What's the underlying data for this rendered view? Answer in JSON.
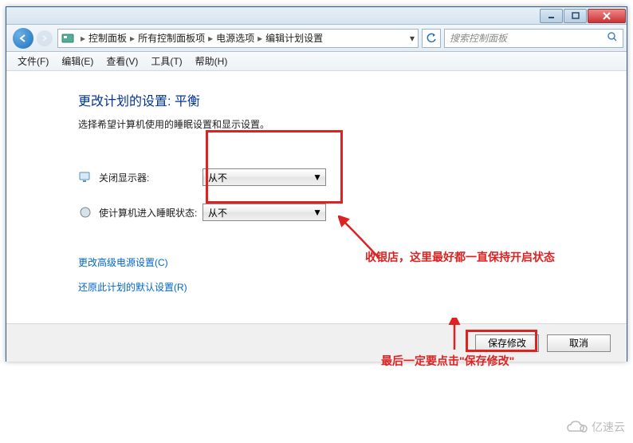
{
  "titlebar": {},
  "breadcrumbs": {
    "item1": "控制面板",
    "item2": "所有控制面板项",
    "item3": "电源选项",
    "item4": "编辑计划设置"
  },
  "search": {
    "placeholder": "搜索控制面板"
  },
  "menu": {
    "file": "文件(F)",
    "edit": "编辑(E)",
    "view": "查看(V)",
    "tools": "工具(T)",
    "help": "帮助(H)"
  },
  "main": {
    "heading": "更改计划的设置: 平衡",
    "subtext": "选择希望计算机使用的睡眠设置和显示设置。",
    "setting1_label": "关闭显示器:",
    "setting1_value": "从不",
    "setting2_label": "使计算机进入睡眠状态:",
    "setting2_value": "从不",
    "link1": "更改高级电源设置(C)",
    "link2": "还原此计划的默认设置(R)"
  },
  "buttons": {
    "save": "保存修改",
    "cancel": "取消"
  },
  "annotations": {
    "note1": "收银店，这里最好都一直保持开启状态",
    "note2": "最后一定要点击\"保存修改\""
  },
  "watermark": {
    "text": "亿速云"
  }
}
